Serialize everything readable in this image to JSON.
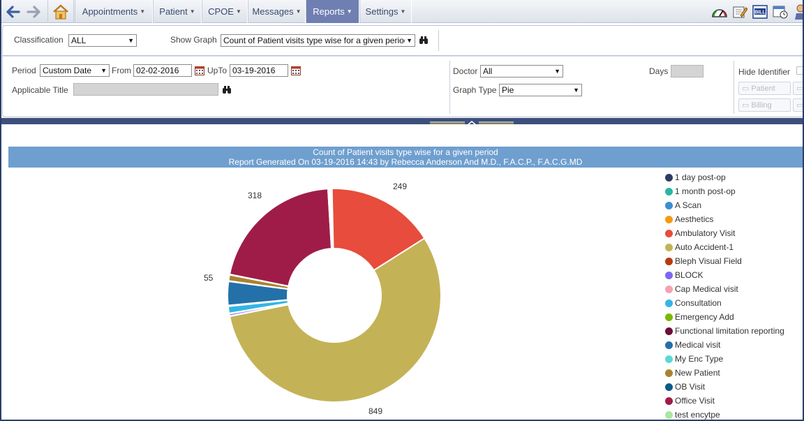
{
  "nav": {
    "menus": [
      {
        "label": "Appointments",
        "active": false
      },
      {
        "label": "Patient",
        "active": false
      },
      {
        "label": "CPOE",
        "active": false
      },
      {
        "label": "Messages",
        "active": false
      },
      {
        "label": "Reports",
        "active": true
      },
      {
        "label": "Settings",
        "active": false
      }
    ],
    "toolbar_icons": [
      "dashboard-gauge-icon",
      "edit-note-icon",
      "bill-icon",
      "calendar-clock-icon",
      "user-icon"
    ],
    "bill_icon_text": "BILL"
  },
  "filters": {
    "classification_label": "Classification",
    "classification_value": "ALL",
    "show_graph_label": "Show Graph",
    "show_graph_value": "Count of Patient visits type wise for a given period",
    "period_label": "Period",
    "period_value": "Custom Date",
    "from_label": "From",
    "from_value": "02-02-2016",
    "upto_label": "UpTo",
    "upto_value": "03-19-2016",
    "applicable_title_label": "Applicable Title",
    "applicable_title_value": "",
    "doctor_label": "Doctor",
    "doctor_value": "All",
    "graph_type_label": "Graph Type",
    "graph_type_value": "Pie",
    "days_label": "Days",
    "days_value": "",
    "hide_identifier_label": "Hide Identifier",
    "patient_button": "Patient",
    "billing_button": "Billing"
  },
  "report": {
    "title": "Count of Patient visits type wise for a given period",
    "subtitle": "Report Generated On 03-19-2016 14:43 by Rebecca Anderson And M.D., F.A.C.P., F.A.C.G.MD"
  },
  "chart_data": {
    "type": "pie",
    "donut": true,
    "categories": [
      "1 day post-op",
      "1 month post-op",
      "A Scan",
      "Aesthetics",
      "Ambulatory Visit",
      "Auto Accident-1",
      "Bleph Visual Field",
      "BLOCK",
      "Cap Medical visit",
      "Consultation",
      "Emergency Add",
      "Functional limitation reporting",
      "Medical visit",
      "My Enc Type",
      "New Patient",
      "OB Visit",
      "Office Visit",
      "test encytpe"
    ],
    "colors": [
      "#2d3b66",
      "#2bb5a0",
      "#3b8fd1",
      "#f39c12",
      "#e74c3c",
      "#c4b257",
      "#b83a0c",
      "#7b68ee",
      "#f5a0b5",
      "#33b5e5",
      "#7ab800",
      "#6b0f3a",
      "#2470a8",
      "#5ad8d8",
      "#a9832f",
      "#0e5a8a",
      "#a01c48",
      "#a8e8a0"
    ],
    "values": [
      3,
      1,
      3,
      1,
      249,
      849,
      1,
      5,
      1,
      16,
      1,
      1,
      55,
      1,
      14,
      1,
      318,
      1
    ],
    "data_labels": [
      "249",
      "849",
      "55",
      "318"
    ],
    "legend_position": "right"
  }
}
